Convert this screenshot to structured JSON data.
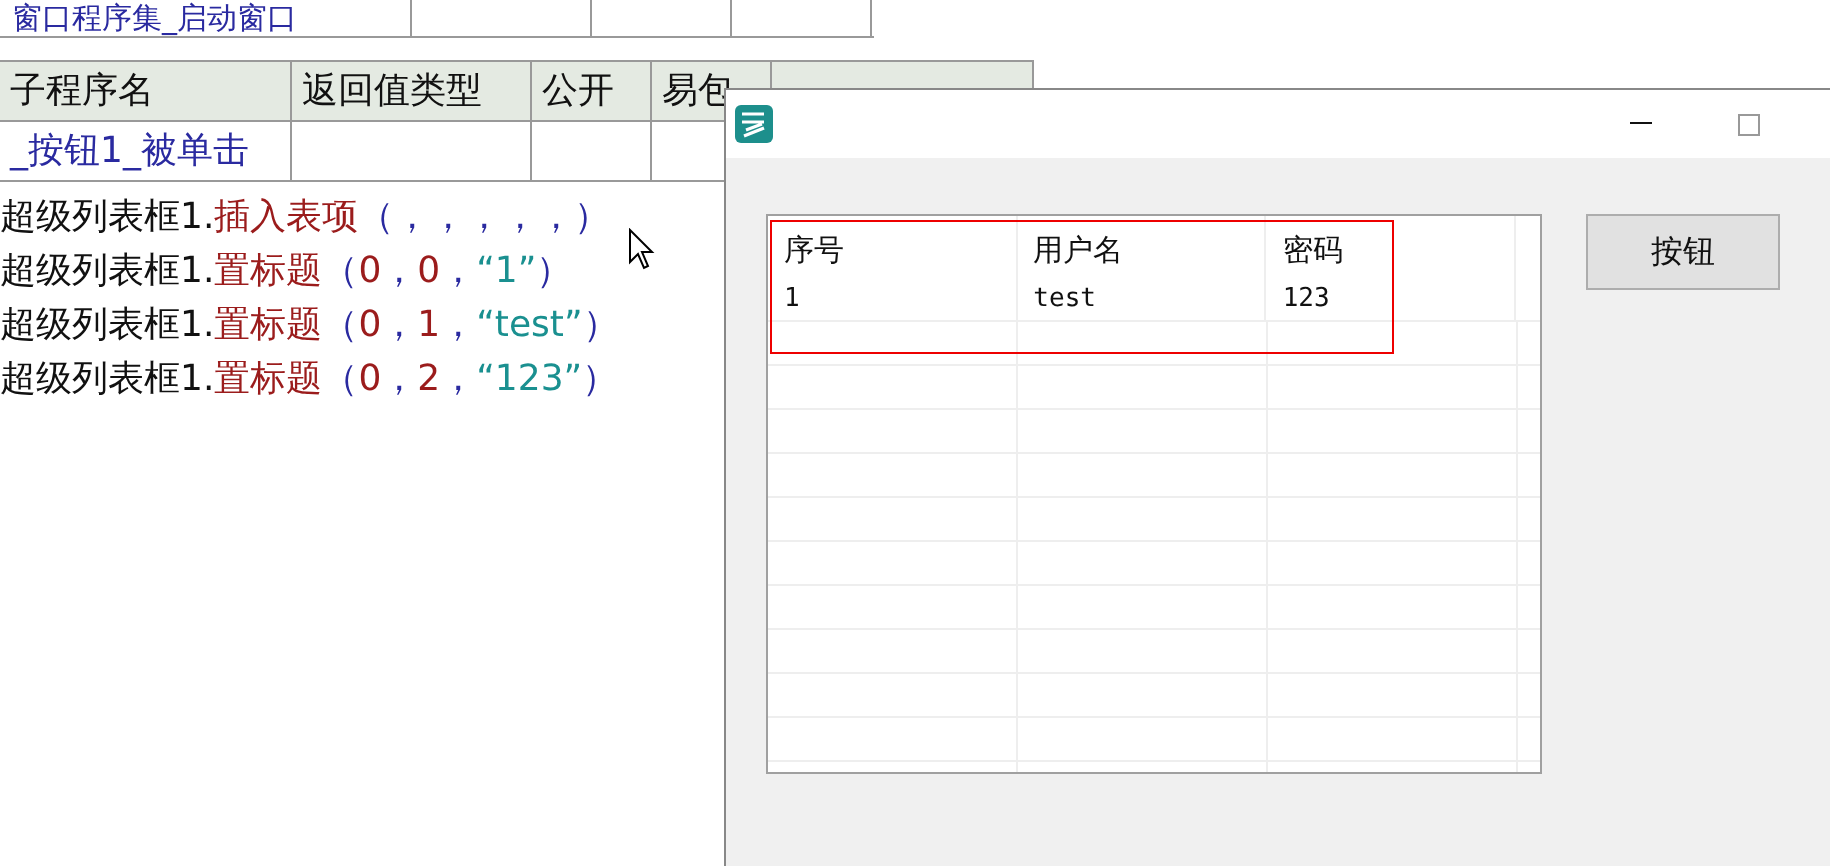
{
  "assembly_table": {
    "cells": [
      "窗口程序集_启动窗口",
      "",
      "",
      ""
    ]
  },
  "sub_table": {
    "columns": [
      "子程序名",
      "返回值类型",
      "公开",
      "易包"
    ],
    "rows": [
      [
        "_按钮1_被单击",
        "",
        ""
      ]
    ]
  },
  "code_lines": [
    {
      "segments": [
        {
          "kind": "object",
          "text": "超级列表框1."
        },
        {
          "kind": "method",
          "text": "插入表项"
        },
        {
          "kind": "punct",
          "text": "（，，，，，）"
        }
      ]
    },
    {
      "segments": [
        {
          "kind": "object",
          "text": "超级列表框1."
        },
        {
          "kind": "method",
          "text": "置标题"
        },
        {
          "kind": "punct",
          "text": "（"
        },
        {
          "kind": "number",
          "text": "0"
        },
        {
          "kind": "punct",
          "text": "，"
        },
        {
          "kind": "number",
          "text": "0"
        },
        {
          "kind": "punct",
          "text": "，"
        },
        {
          "kind": "string",
          "text": "“1”"
        },
        {
          "kind": "punct",
          "text": "）"
        }
      ]
    },
    {
      "segments": [
        {
          "kind": "object",
          "text": "超级列表框1."
        },
        {
          "kind": "method",
          "text": "置标题"
        },
        {
          "kind": "punct",
          "text": "（"
        },
        {
          "kind": "number",
          "text": "0"
        },
        {
          "kind": "punct",
          "text": "，"
        },
        {
          "kind": "number",
          "text": "1"
        },
        {
          "kind": "punct",
          "text": "，"
        },
        {
          "kind": "string",
          "text": "“test”"
        },
        {
          "kind": "punct",
          "text": "）"
        }
      ]
    },
    {
      "segments": [
        {
          "kind": "object",
          "text": "超级列表框1."
        },
        {
          "kind": "method",
          "text": "置标题"
        },
        {
          "kind": "punct",
          "text": "（"
        },
        {
          "kind": "number",
          "text": "0"
        },
        {
          "kind": "punct",
          "text": "，"
        },
        {
          "kind": "number",
          "text": "2"
        },
        {
          "kind": "punct",
          "text": "，"
        },
        {
          "kind": "string",
          "text": "“123”"
        },
        {
          "kind": "punct",
          "text": "）"
        }
      ]
    }
  ],
  "dialog": {
    "list": {
      "columns": [
        "序号",
        "用户名",
        "密码"
      ],
      "rows": [
        [
          "1",
          "test",
          "123"
        ]
      ]
    },
    "button": "按钮"
  }
}
